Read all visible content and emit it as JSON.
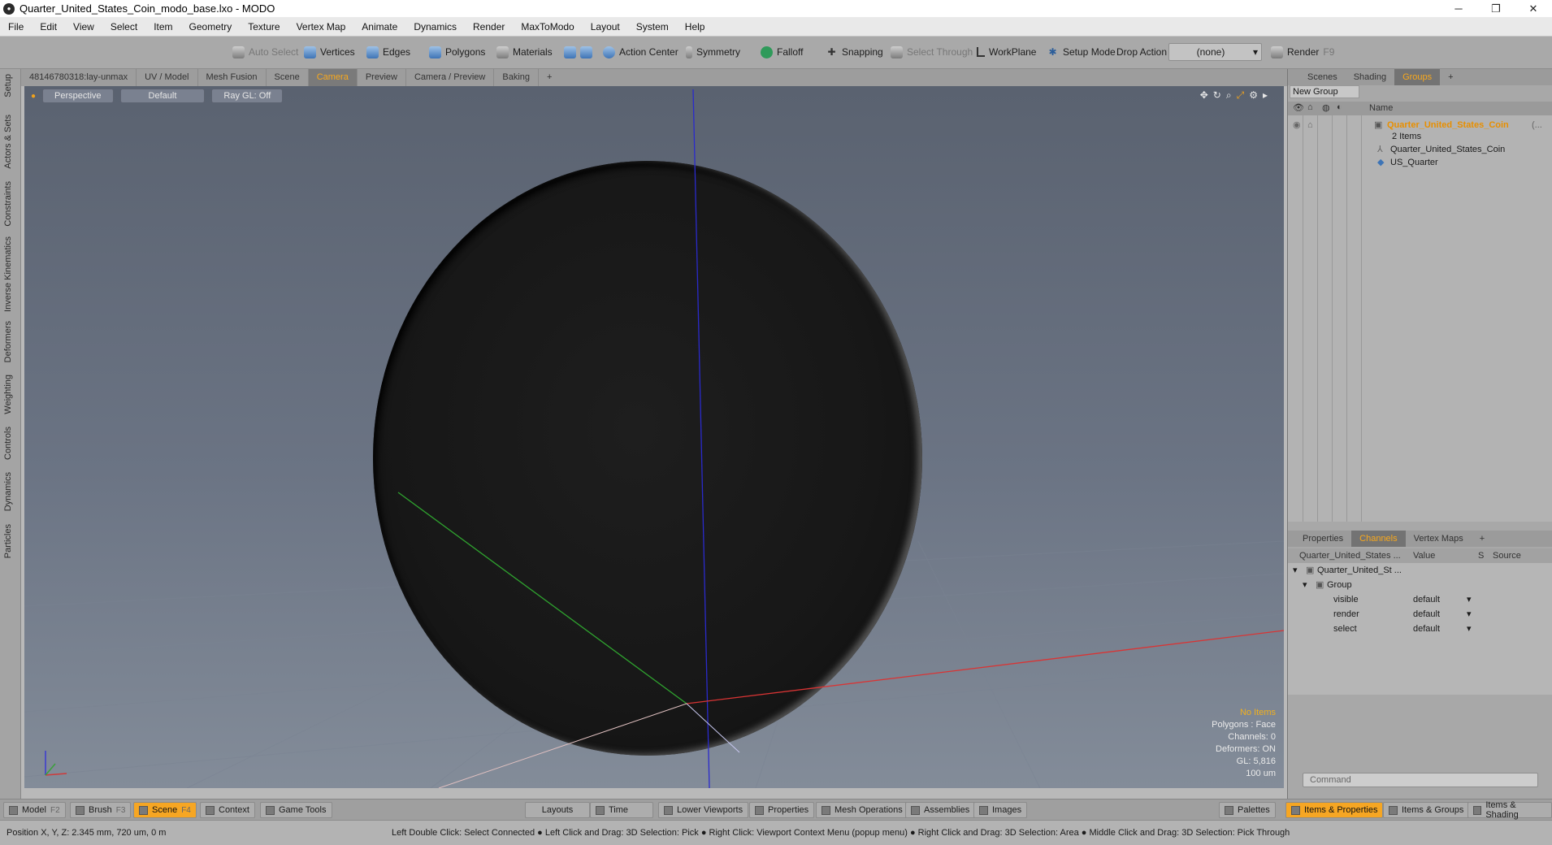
{
  "window": {
    "title": "Quarter_United_States_Coin_modo_base.lxo - MODO",
    "minimize": "─",
    "restore": "❐",
    "close": "✕"
  },
  "menu": [
    "File",
    "Edit",
    "View",
    "Select",
    "Item",
    "Geometry",
    "Texture",
    "Vertex Map",
    "Animate",
    "Dynamics",
    "Render",
    "MaxToModo",
    "Layout",
    "System",
    "Help"
  ],
  "toolbar": {
    "auto_select": "Auto Select",
    "vertices": "Vertices",
    "edges": "Edges",
    "polygons": "Polygons",
    "materials": "Materials",
    "action_center": "Action Center",
    "symmetry": "Symmetry",
    "falloff": "Falloff",
    "snapping": "Snapping",
    "select_through": "Select Through",
    "workplane": "WorkPlane",
    "setup_mode": "Setup Mode",
    "drop_action": "Drop Action",
    "drop_value": "(none)",
    "render": "Render",
    "render_key": "F9"
  },
  "left_tabs": [
    "Setup",
    "Actors & Sets",
    "Constraints",
    "Inverse Kinematics",
    "Deformers",
    "Weighting",
    "Controls",
    "Dynamics",
    "Particles"
  ],
  "viewport_tabs": [
    "48146780318:lay-unmax",
    "UV / Model",
    "Mesh Fusion",
    "Scene",
    "Camera",
    "Preview",
    "Camera / Preview",
    "Baking",
    "+"
  ],
  "viewport_bar": {
    "view": "Perspective",
    "shading": "Default",
    "raygl": "Ray GL: Off"
  },
  "viewport_icons": [
    "✥",
    "↻",
    "⌕",
    "⤢",
    "⚙",
    "▸"
  ],
  "viewport_info": {
    "items": "No Items",
    "polygons": "Polygons : Face",
    "channels": "Channels: 0",
    "deformers": "Deformers: ON",
    "gl": "GL: 5,816",
    "scale": "100 um"
  },
  "right_tabs": [
    "Scenes",
    "Shading",
    "Groups",
    "+"
  ],
  "groups": {
    "new_group": "New Group",
    "name_header": "Name",
    "root_name": "Quarter_United_States_Coin",
    "root_ellipsis": "(...",
    "root_count": "2 Items",
    "children": [
      "Quarter_United_States_Coin",
      "US_Quarter"
    ]
  },
  "prop_tabs": [
    "Properties",
    "Channels",
    "Vertex Maps",
    "+"
  ],
  "channels": {
    "col_name": "Quarter_United_States ...",
    "col_value": "Value",
    "col_s": "S",
    "col_source": "Source",
    "item": "Quarter_United_St ...",
    "group": "Group",
    "rows": [
      {
        "name": "visible",
        "value": "default"
      },
      {
        "name": "render",
        "value": "default"
      },
      {
        "name": "select",
        "value": "default"
      }
    ]
  },
  "command_placeholder": "Command",
  "bottom": {
    "model": "Model",
    "model_key": "F2",
    "brush": "Brush",
    "brush_key": "F3",
    "scene": "Scene",
    "scene_key": "F4",
    "context": "Context",
    "game_tools": "Game Tools",
    "layouts": "Layouts",
    "time": "Time",
    "lower_viewports": "Lower Viewports",
    "properties": "Properties",
    "mesh_operations": "Mesh Operations",
    "assemblies": "Assemblies",
    "images": "Images",
    "palettes": "Palettes",
    "items_properties": "Items & Properties",
    "items_groups": "Items & Groups",
    "items_shading": "Items & Shading"
  },
  "status": {
    "position": "Position X, Y, Z:  2.345 mm, 720 um, 0 m",
    "hints": "Left Double Click: Select Connected ● Left Click and Drag: 3D Selection: Pick ● Right Click: Viewport Context Menu (popup menu) ● Right Click and Drag: 3D Selection: Area ● Middle Click and Drag: 3D Selection: Pick Through"
  }
}
